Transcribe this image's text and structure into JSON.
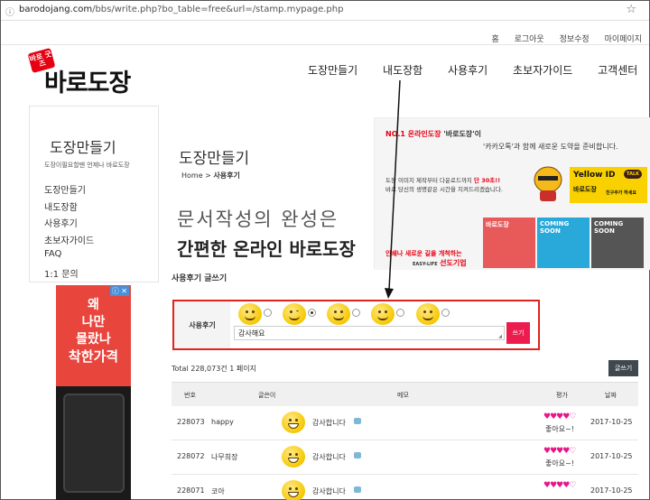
{
  "browser": {
    "url_host": "barodojang.com",
    "url_path": "/bbs/write.php?bo_table=free&url=/stamp.mypage.php"
  },
  "top_links": [
    "홈",
    "로그아웃",
    "정보수정",
    "마이페이지"
  ],
  "logo": {
    "badge": "바로 굿즈",
    "text": "바로도장"
  },
  "main_nav": [
    "도장만들기",
    "내도장함",
    "사용후기",
    "초보자가이드",
    "고객센터"
  ],
  "sidebar": {
    "title": "도장만들기",
    "subtitle": "도장이필요할땐 언제나 바로도장",
    "items": [
      "도장만들기",
      "내도장함",
      "사용후기",
      "초보자가이드",
      "FAQ",
      "1:1 문의"
    ]
  },
  "ad": {
    "lines": [
      "왜",
      "나만",
      "몰랐나",
      "착한가격"
    ],
    "close": "ⓘ ✕"
  },
  "page": {
    "title": "도장만들기",
    "breadcrumb_home": "Home",
    "breadcrumb_current": "사용후기",
    "hero_line1": "문서작성의 완성은",
    "hero_line2": "간편한 온라인 바로도장"
  },
  "banner": {
    "line1_red": "NO.1 온라인도장",
    "line1_rest": " '바로도장'이",
    "line2": "'카카오톡'과 함께 새로운 도약을 준비합니다.",
    "line3a": "도장 이미지 제작부터 다운로드까지 ",
    "line3_red": "단 30초!!",
    "line3b": "바로 당신의 생명같은 시간을 지켜드리겠습니다.",
    "yellow_id": "Yellow ID",
    "yellow_name": "바로도장",
    "yellow_cta": "친구추가 하세요",
    "talk": "TALK",
    "tile1": "바로도장",
    "tile2": "COMING SOON",
    "tile3": "COMING SOON",
    "tagline_red": "인쇄나 새로운 길을 개척하는",
    "tagline_brand": "선도기업",
    "tagline_small": "EASY-LIFE"
  },
  "section_title": "사용후기 글쓰기",
  "write_form": {
    "label": "사용후기",
    "memo_value": "감사해요",
    "submit": "쓰기",
    "selected_emoticon": 1
  },
  "list": {
    "total_text": "Total 228,073건 1 페이지",
    "write_button": "글쓰기",
    "headers": {
      "no": "번호",
      "author": "글쓴이",
      "memo": "메모",
      "rating": "평가",
      "date": "날짜"
    },
    "rows": [
      {
        "no": "228073",
        "author": "happy",
        "memo": "감사합니다",
        "hearts": "♥♥♥♥♡",
        "like": "좋아요~!",
        "date": "2017-10-25"
      },
      {
        "no": "228072",
        "author": "나무희장",
        "memo": "감사합니다",
        "hearts": "♥♥♥♥♡",
        "like": "좋아요~!",
        "date": "2017-10-25"
      },
      {
        "no": "228071",
        "author": "코아",
        "memo": "감사합니다",
        "hearts": "♥♥♥♥♡",
        "like": "",
        "date": "2017-10-25"
      }
    ]
  },
  "colors": {
    "accent_red": "#e0231c",
    "submit_pink": "#ec1c4f",
    "heart": "#e6168a"
  }
}
